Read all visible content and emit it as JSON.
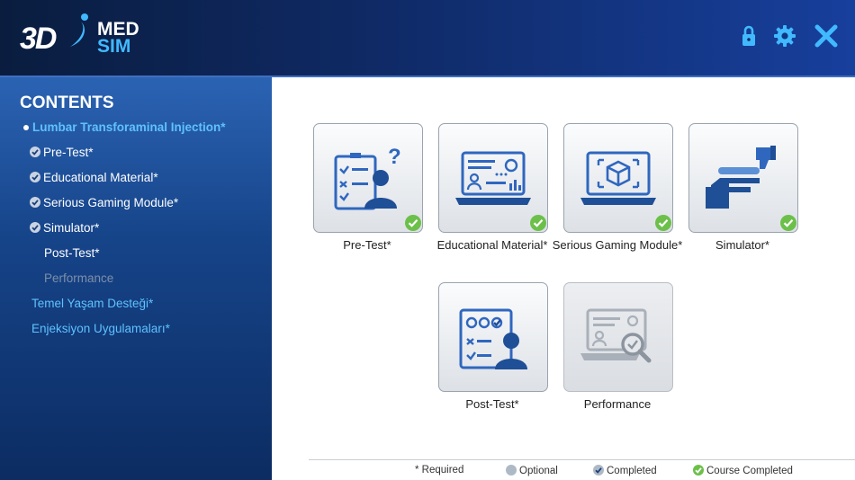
{
  "brand": {
    "logo_prefix": "3D",
    "logo_line1": "MED",
    "logo_line2": "SIM"
  },
  "header_icons": [
    "lock-icon",
    "gear-icon",
    "close-icon"
  ],
  "sidebar": {
    "title": "CONTENTS",
    "main_item": "Lumbar Transforaminal Injection*",
    "sub_items": [
      {
        "label": "Pre-Test*",
        "status": "completed"
      },
      {
        "label": "Educational Material*",
        "status": "completed"
      },
      {
        "label": "Serious Gaming Module*",
        "status": "completed"
      },
      {
        "label": "Simulator*",
        "status": "completed"
      },
      {
        "label": "Post-Test*",
        "status": "none"
      },
      {
        "label": "Performance",
        "status": "disabled"
      }
    ],
    "other_courses": [
      "Temel Yaşam Desteği*",
      "Enjeksiyon Uygulamaları*"
    ]
  },
  "modules": [
    {
      "label": "Pre-Test*",
      "completed": true
    },
    {
      "label": "Educational Material*",
      "completed": true
    },
    {
      "label": "Serious Gaming Module*",
      "completed": true
    },
    {
      "label": "Simulator*",
      "completed": true
    },
    {
      "label": "Post-Test*",
      "completed": false
    },
    {
      "label": "Performance",
      "completed": false,
      "disabled": true
    }
  ],
  "legend": {
    "required": "* Required",
    "optional": "Optional",
    "completed": "Completed",
    "course_completed": "Course Completed"
  },
  "colors": {
    "header_dark": "#0a1d3f",
    "header_light": "#173f9c",
    "accent_blue": "#5fc1ff",
    "icon_blue": "#2f67bf",
    "complete_green": "#6cc04a",
    "check_gray": "#c9d3e2"
  }
}
